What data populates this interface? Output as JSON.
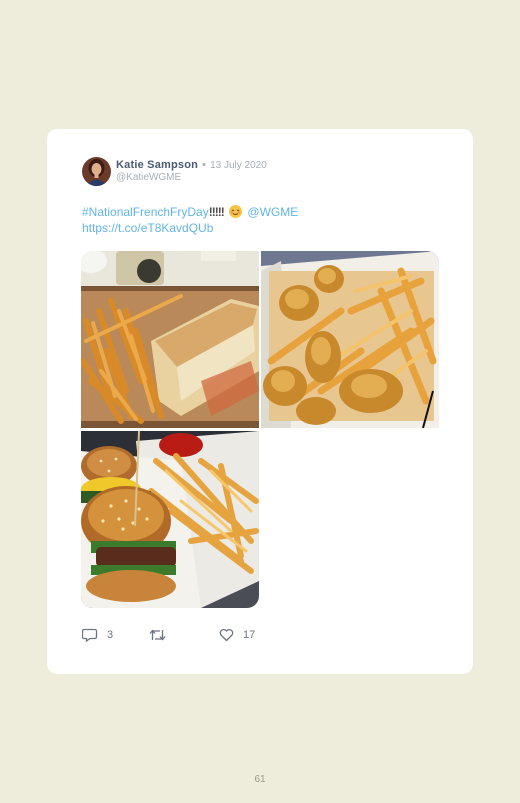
{
  "tweet": {
    "author_name": "Katie Sampson",
    "separator": "•",
    "date": "13 July 2020",
    "handle": "@KatieWGME",
    "hashtag": "#NationalFrenchFryDay",
    "exclaims": "!!!!!",
    "emoji": "relieved-face-emoji",
    "mention": "@WGME",
    "link": "https://t.co/eT8KavdQUb",
    "images": [
      "fries-and-grilled-sandwich-photo",
      "fried-scallops-and-fries-photo",
      "burger-and-fries-photo"
    ],
    "actions": {
      "replies": "3",
      "likes": "17"
    }
  },
  "page": {
    "number": "61"
  },
  "colors": {
    "page_bg": "#eeeddb",
    "card_bg": "#ffffff",
    "link": "#62b4e6",
    "name": "#4a5a70",
    "muted": "#a8aeb6"
  }
}
